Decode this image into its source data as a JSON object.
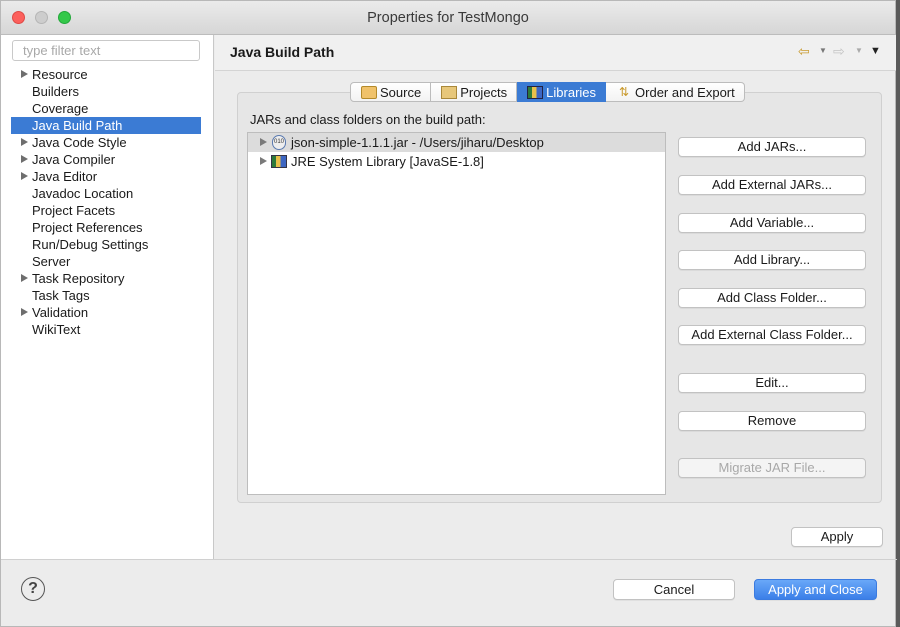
{
  "window": {
    "title": "Properties for TestMongo"
  },
  "filter": {
    "placeholder": "type filter text"
  },
  "nav": {
    "items": [
      {
        "label": "Resource",
        "expandable": true
      },
      {
        "label": "Builders",
        "expandable": false
      },
      {
        "label": "Coverage",
        "expandable": false
      },
      {
        "label": "Java Build Path",
        "expandable": false,
        "selected": true
      },
      {
        "label": "Java Code Style",
        "expandable": true
      },
      {
        "label": "Java Compiler",
        "expandable": true
      },
      {
        "label": "Java Editor",
        "expandable": true
      },
      {
        "label": "Javadoc Location",
        "expandable": false
      },
      {
        "label": "Project Facets",
        "expandable": false
      },
      {
        "label": "Project References",
        "expandable": false
      },
      {
        "label": "Run/Debug Settings",
        "expandable": false
      },
      {
        "label": "Server",
        "expandable": false
      },
      {
        "label": "Task Repository",
        "expandable": true
      },
      {
        "label": "Task Tags",
        "expandable": false
      },
      {
        "label": "Validation",
        "expandable": true
      },
      {
        "label": "WikiText",
        "expandable": false
      }
    ]
  },
  "page": {
    "title": "Java Build Path"
  },
  "tabs": [
    {
      "label": "Source",
      "icon": "source-folder-icon"
    },
    {
      "label": "Projects",
      "icon": "projects-folder-icon"
    },
    {
      "label": "Libraries",
      "icon": "libraries-icon",
      "active": true
    },
    {
      "label": "Order and Export",
      "icon": "order-export-icon"
    }
  ],
  "libraries": {
    "label": "JARs and class folders on the build path:",
    "entries": [
      {
        "label": "json-simple-1.1.1.jar - /Users/jiharu/Desktop",
        "icon": "jar-icon",
        "jar_icon_text": "010"
      },
      {
        "label": "JRE System Library [JavaSE-1.8]",
        "icon": "library-icon"
      }
    ]
  },
  "buttons": {
    "add_jars": "Add JARs...",
    "add_external_jars": "Add External JARs...",
    "add_variable": "Add Variable...",
    "add_library": "Add Library...",
    "add_class_folder": "Add Class Folder...",
    "add_external_class_folder": "Add External Class Folder...",
    "edit": "Edit...",
    "remove": "Remove",
    "migrate_jar": "Migrate JAR File...",
    "apply": "Apply",
    "cancel": "Cancel",
    "apply_and_close": "Apply and Close"
  },
  "help": {
    "glyph": "?"
  },
  "colors": {
    "selection": "#3b7bd4",
    "primary_button": "#3b7fe8"
  }
}
